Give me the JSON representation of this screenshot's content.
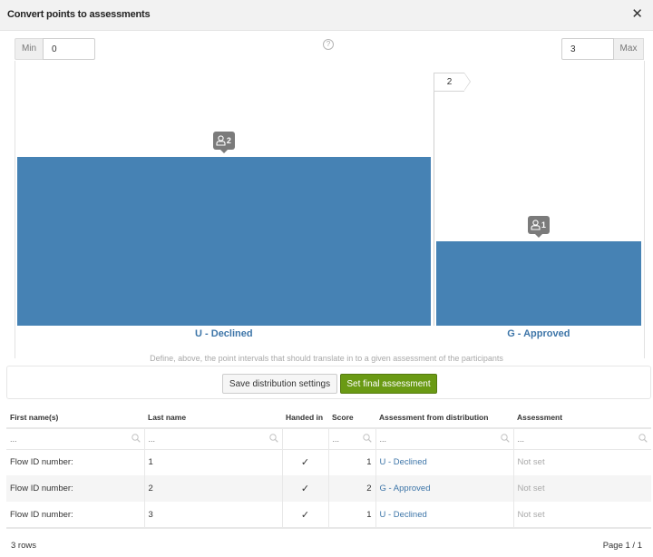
{
  "dialog": {
    "title": "Convert points to assessments",
    "close_icon": "close-icon"
  },
  "range": {
    "min_label": "Min",
    "min_value": "0",
    "max_label": "Max",
    "max_value": "3",
    "help_icon": "question-circle-icon",
    "help_glyph": "?"
  },
  "threshold": {
    "value": "2"
  },
  "chart_data": {
    "type": "bar",
    "categories": [
      "U - Declined",
      "G - Approved"
    ],
    "values": [
      2,
      1
    ],
    "intervals": [
      [
        0,
        2
      ],
      [
        2,
        3
      ]
    ],
    "badges": [
      "2",
      "1"
    ],
    "badge_icon": "user-icon",
    "ylim": [
      0,
      2
    ],
    "bar_color": "#4682b4",
    "label_color": "#3d75a8"
  },
  "hint": "Define, above, the point intervals that should translate in to a given assessment of the participants",
  "actions": {
    "save_label": "Save distribution settings",
    "final_label": "Set final assessment"
  },
  "table": {
    "headers": [
      "First name(s)",
      "Last name",
      "Handed in",
      "Score",
      "Assessment from distribution",
      "Assessment"
    ],
    "filter_placeholder": "...",
    "rows": [
      {
        "first": "Flow ID number:",
        "last": "1",
        "handed_in": "✓",
        "score": "1",
        "distribution": "U - Declined",
        "assessment": "Not set"
      },
      {
        "first": "Flow ID number:",
        "last": "2",
        "handed_in": "✓",
        "score": "2",
        "distribution": "G - Approved",
        "assessment": "Not set"
      },
      {
        "first": "Flow ID number:",
        "last": "3",
        "handed_in": "✓",
        "score": "1",
        "distribution": "U - Declined",
        "assessment": "Not set"
      }
    ]
  },
  "footer": {
    "row_count": "3 rows",
    "page": "Page 1 / 1"
  },
  "colors": {
    "accent_blue": "#4682b4",
    "button_green": "#6a9a14"
  }
}
